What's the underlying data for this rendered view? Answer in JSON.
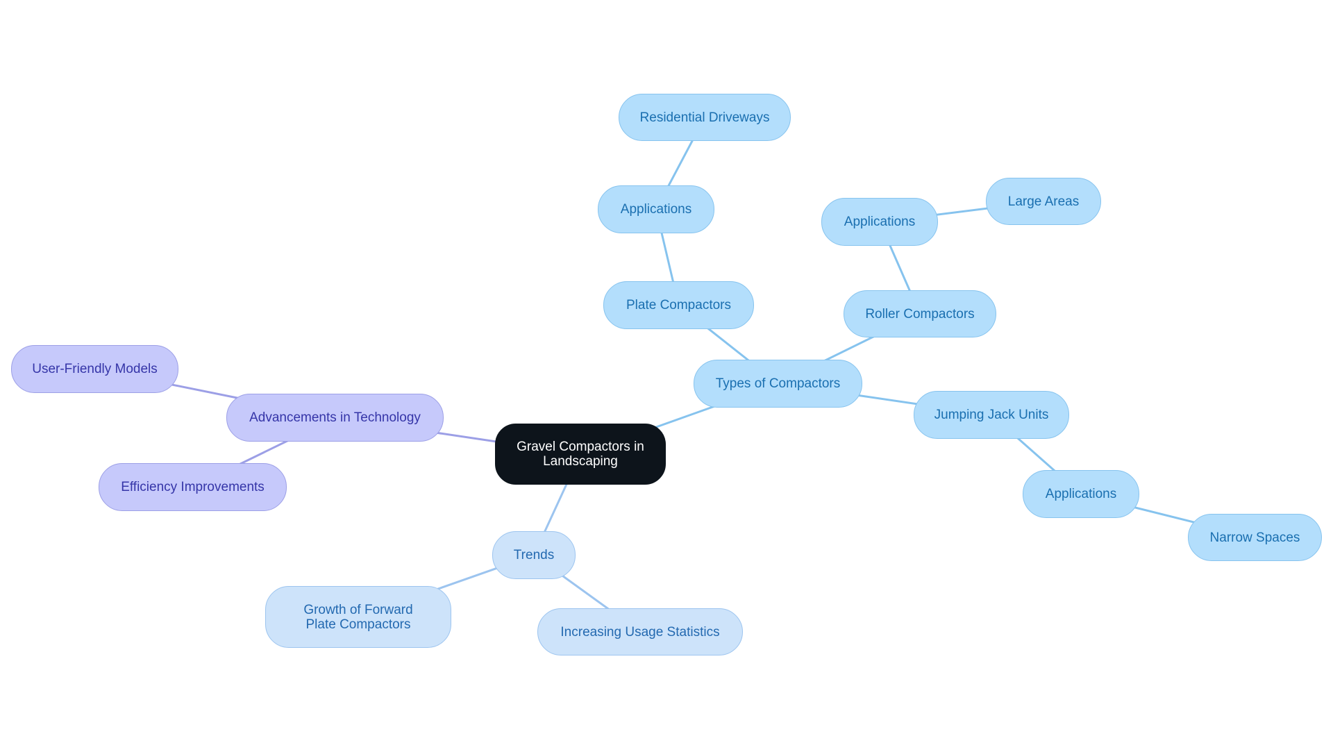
{
  "diagram": {
    "type": "mindmap",
    "root": {
      "id": "root",
      "label": "Gravel Compactors in Landscaping"
    },
    "colors": {
      "root_fill": "#0d141b",
      "root_text": "#ffffff",
      "blue_fill": "#b3defc",
      "blue_text": "#1a6fb0",
      "blue_edge": "#86c3ee",
      "lightblue_fill": "#cde3fa",
      "lightblue_text": "#2369b0",
      "lightblue_edge": "#9cc4ef",
      "purple_fill": "#c6c9fb",
      "purple_text": "#3535a8",
      "purple_edge": "#9c9fe6"
    },
    "nodes": [
      {
        "id": "types",
        "label": "Types of Compactors",
        "parent": "root",
        "theme": "blue"
      },
      {
        "id": "plate",
        "label": "Plate Compactors",
        "parent": "types",
        "theme": "blue"
      },
      {
        "id": "plate_app",
        "label": "Applications",
        "parent": "plate",
        "theme": "blue"
      },
      {
        "id": "residential",
        "label": "Residential Driveways",
        "parent": "plate_app",
        "theme": "blue"
      },
      {
        "id": "roller",
        "label": "Roller Compactors",
        "parent": "types",
        "theme": "blue"
      },
      {
        "id": "roller_app",
        "label": "Applications",
        "parent": "roller",
        "theme": "blue"
      },
      {
        "id": "large",
        "label": "Large Areas",
        "parent": "roller_app",
        "theme": "blue"
      },
      {
        "id": "jumping",
        "label": "Jumping Jack Units",
        "parent": "types",
        "theme": "blue"
      },
      {
        "id": "jumping_app",
        "label": "Applications",
        "parent": "jumping",
        "theme": "blue"
      },
      {
        "id": "narrow",
        "label": "Narrow Spaces",
        "parent": "jumping_app",
        "theme": "blue"
      },
      {
        "id": "advancements",
        "label": "Advancements in Technology",
        "parent": "root",
        "theme": "purple"
      },
      {
        "id": "userfriendly",
        "label": "User-Friendly Models",
        "parent": "advancements",
        "theme": "purple"
      },
      {
        "id": "efficiency",
        "label": "Efficiency Improvements",
        "parent": "advancements",
        "theme": "purple"
      },
      {
        "id": "trends",
        "label": "Trends",
        "parent": "root",
        "theme": "lightblue"
      },
      {
        "id": "growth",
        "label": "Growth of Forward Plate Compactors",
        "parent": "trends",
        "theme": "lightblue"
      },
      {
        "id": "usage",
        "label": "Increasing Usage Statistics",
        "parent": "trends",
        "theme": "lightblue"
      }
    ]
  }
}
